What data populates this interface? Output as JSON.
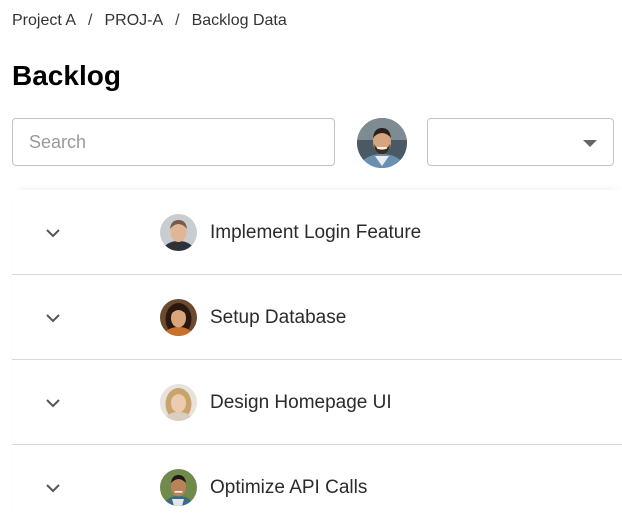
{
  "breadcrumb": {
    "items": [
      "Project A",
      "PROJ-A",
      "Backlog Data"
    ],
    "separator": "/"
  },
  "page": {
    "title": "Backlog"
  },
  "search": {
    "placeholder": "Search",
    "value": ""
  },
  "header_avatar": {
    "icon": "user-avatar"
  },
  "filter_select": {
    "selected": "",
    "icon": "dropdown-arrow-icon"
  },
  "backlog": {
    "items": [
      {
        "title": "Implement Login Feature",
        "avatar": "assignee-avatar",
        "expand_icon": "chevron-down-icon"
      },
      {
        "title": "Setup Database",
        "avatar": "assignee-avatar",
        "expand_icon": "chevron-down-icon"
      },
      {
        "title": "Design Homepage UI",
        "avatar": "assignee-avatar",
        "expand_icon": "chevron-down-icon"
      },
      {
        "title": "Optimize API Calls",
        "avatar": "assignee-avatar",
        "expand_icon": "chevron-down-icon"
      }
    ]
  },
  "colors": {
    "text": "#1f1f1f",
    "border": "#c4c4c4",
    "divider": "#d9d9d9",
    "placeholder": "#9a9a9a"
  }
}
